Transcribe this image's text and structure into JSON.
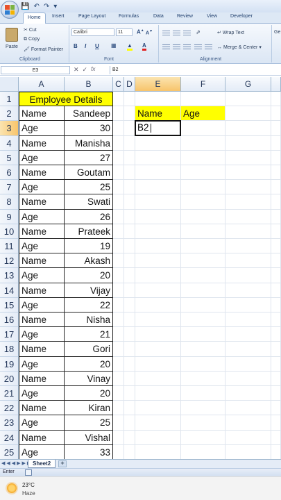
{
  "quick_access": {
    "save_icon": "save-icon",
    "undo_icon": "undo-icon",
    "redo_icon": "redo-icon"
  },
  "tabs": [
    "Home",
    "Insert",
    "Page Layout",
    "Formulas",
    "Data",
    "Review",
    "View",
    "Developer"
  ],
  "ribbon": {
    "clipboard": {
      "paste": "Paste",
      "cut": "Cut",
      "copy": "Copy",
      "format_painter": "Format Painter",
      "label": "Clipboard"
    },
    "font": {
      "name": "Calibri",
      "size": "11",
      "bold": "B",
      "italic": "I",
      "underline": "U",
      "label": "Font"
    },
    "alignment": {
      "wrap_text": "Wrap Text",
      "merge_center": "Merge & Center",
      "label": "Alignment"
    },
    "overflow": "Ge"
  },
  "formula_bar": {
    "name_box": "E3",
    "fx": "fx",
    "content": "B2"
  },
  "columns": [
    "A",
    "B",
    "C",
    "D",
    "E",
    "F",
    "G"
  ],
  "rows": [
    "1",
    "2",
    "3",
    "4",
    "5",
    "6",
    "7",
    "8",
    "9",
    "10",
    "11",
    "12",
    "13",
    "14",
    "15",
    "16",
    "17",
    "18",
    "19",
    "20",
    "21",
    "22",
    "23",
    "24",
    "25"
  ],
  "cells": {
    "title": "Employee Details",
    "table": [
      [
        "Name",
        "Sandeep"
      ],
      [
        "Age",
        "30"
      ],
      [
        "Name",
        "Manisha"
      ],
      [
        "Age",
        "27"
      ],
      [
        "Name",
        "Goutam"
      ],
      [
        "Age",
        "25"
      ],
      [
        "Name",
        "Swati"
      ],
      [
        "Age",
        "26"
      ],
      [
        "Name",
        "Prateek"
      ],
      [
        "Age",
        "19"
      ],
      [
        "Name",
        "Akash"
      ],
      [
        "Age",
        "20"
      ],
      [
        "Name",
        "Vijay"
      ],
      [
        "Age",
        "22"
      ],
      [
        "Name",
        "Nisha"
      ],
      [
        "Age",
        "21"
      ],
      [
        "Name",
        "Gori"
      ],
      [
        "Age",
        "20"
      ],
      [
        "Name",
        "Vinay"
      ],
      [
        "Age",
        "20"
      ],
      [
        "Name",
        "Kiran"
      ],
      [
        "Age",
        "25"
      ],
      [
        "Name",
        "Vishal"
      ],
      [
        "Age",
        "33"
      ]
    ],
    "e2": "Name",
    "f2": "Age",
    "e3": "B2"
  },
  "sheet_tabs": [
    "Sheet2"
  ],
  "status": {
    "mode": "Enter"
  },
  "taskbar": {
    "temperature": "23°C",
    "condition": "Haze"
  },
  "colors": {
    "highlight": "#ffff00",
    "selected_header": "#f7c46b"
  }
}
